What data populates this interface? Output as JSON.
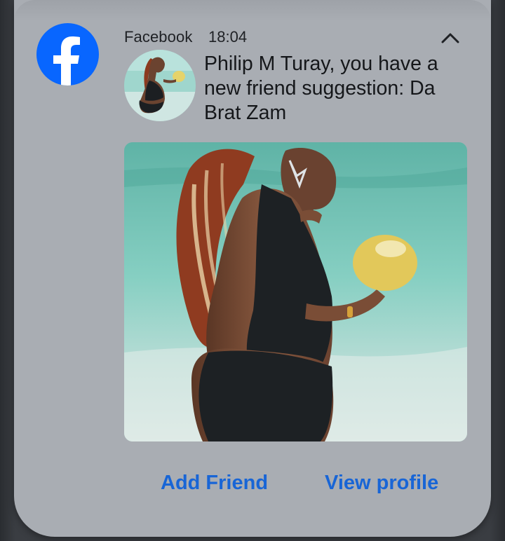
{
  "notification": {
    "app_icon": "facebook-icon",
    "app_name": "Facebook",
    "time": "18:04",
    "collapse_icon": "chevron-up-icon",
    "message": "Philip M Turay, you have a new friend suggestion: Da Brat Zam",
    "photo_description": "beach-photo",
    "actions": {
      "add_friend": "Add Friend",
      "view_profile": "View profile"
    }
  },
  "colors": {
    "card_background": "#a9adb3",
    "facebook_blue": "#0866ff",
    "action_blue": "#1865d6",
    "text": "#15171a"
  }
}
